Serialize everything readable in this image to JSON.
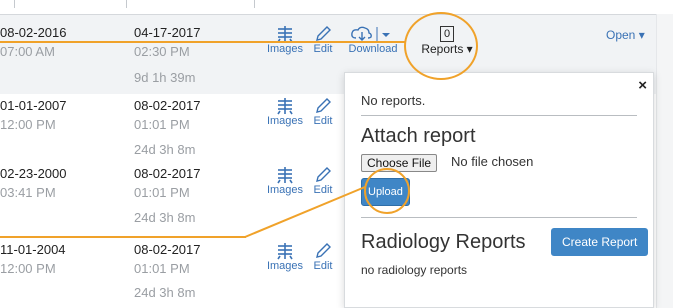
{
  "rows": [
    {
      "date_from": "08-02-2016",
      "time_from": "07:00 AM",
      "date_to": "04-17-2017",
      "time_to": "02:30 PM",
      "duration": "9d 1h 39m"
    },
    {
      "date_from": "01-01-2007",
      "time_from": "12:00 PM",
      "date_to": "08-02-2017",
      "time_to": "01:01 PM",
      "duration": "24d 3h 8m"
    },
    {
      "date_from": "02-23-2000",
      "time_from": "03:41 PM",
      "date_to": "08-02-2017",
      "time_to": "01:01 PM",
      "duration": "24d 3h 8m"
    },
    {
      "date_from": "11-01-2004",
      "time_from": "12:00 PM",
      "date_to": "08-02-2017",
      "time_to": "01:01 PM",
      "duration": "24d 3h 8m"
    }
  ],
  "actions": {
    "images": "Images",
    "edit": "Edit",
    "download": "Download",
    "reports": "Reports ▾",
    "reports_count": "0",
    "open": "Open ▾"
  },
  "popover": {
    "close": "×",
    "no_reports": "No reports.",
    "attach_title": "Attach report",
    "choose_file": "Choose File",
    "no_file": "No file chosen",
    "upload": "Upload",
    "radiology_title": "Radiology Reports",
    "create_report": "Create Report",
    "no_radiology": "no radiology reports"
  },
  "colors": {
    "accent": "#3a72b5",
    "button": "#3f86c6",
    "highlight": "#f0a22a"
  }
}
